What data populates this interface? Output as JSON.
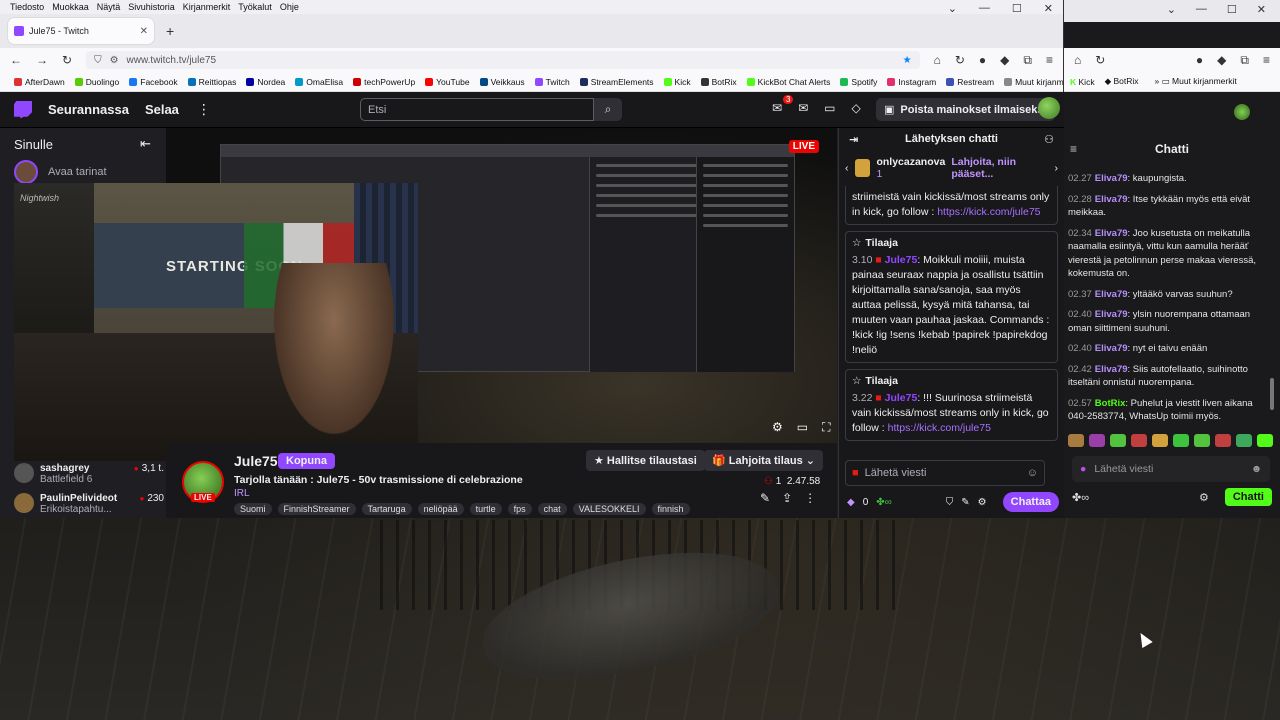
{
  "menubar": [
    "Tiedosto",
    "Muokkaa",
    "Näytä",
    "Sivuhistoria",
    "Kirjanmerkit",
    "Työkalut",
    "Ohje"
  ],
  "tab": {
    "title": "Jule75 - Twitch",
    "close": "✕",
    "new": "+"
  },
  "url": "www.twitch.tv/jule75",
  "bookmarks": [
    {
      "label": "AfterDawn",
      "color": "#d33"
    },
    {
      "label": "Duolingo",
      "color": "#58cc02"
    },
    {
      "label": "Facebook",
      "color": "#1877f2"
    },
    {
      "label": "Reittiopas",
      "color": "#0073bc"
    },
    {
      "label": "Nordea",
      "color": "#0000a0"
    },
    {
      "label": "OmaElisa",
      "color": "#0099cc"
    },
    {
      "label": "techPowerUp",
      "color": "#c00"
    },
    {
      "label": "YouTube",
      "color": "#f00"
    },
    {
      "label": "Veikkaus",
      "color": "#004b87"
    },
    {
      "label": "Twitch",
      "color": "#9147ff"
    },
    {
      "label": "StreamElements",
      "color": "#1f2d5a"
    },
    {
      "label": "Kick",
      "color": "#53fc18"
    },
    {
      "label": "BotRix",
      "color": "#333"
    },
    {
      "label": "KickBot Chat Alerts",
      "color": "#53fc18"
    },
    {
      "label": "Spotify",
      "color": "#1db954"
    },
    {
      "label": "Instagram",
      "color": "#e1306c"
    },
    {
      "label": "Restream",
      "color": "#3f51b5"
    },
    {
      "label": "Muut kirjanmerkit",
      "color": "#888"
    }
  ],
  "twitch": {
    "following": "Seurannassa",
    "browse": "Selaa",
    "search_placeholder": "Etsi",
    "notif_count": "3",
    "ad_free": "Poista mainokset ilmaiseksi"
  },
  "sidebar": {
    "title": "Sinulle",
    "story": "Avaa tarinat",
    "channels": [
      {
        "name": "sashagrey",
        "game": "Battlefield 6",
        "viewers": "3,1 t."
      },
      {
        "name": "PaulinPelivideot",
        "game": "Erikoistapahtu...",
        "viewers": "230"
      }
    ]
  },
  "video": {
    "live": "LIVE",
    "starting": "STARTING SOON",
    "overlay_left": "Nightwish"
  },
  "stream": {
    "name": "Jule75",
    "follow": "Kopuna",
    "live": "LIVE",
    "title": "Tarjolla tänään : Jule75 - 50v trasmissione di celebrazione",
    "game": "IRL",
    "tags": [
      "Suomi",
      "FinnishStreamer",
      "Tartaruga",
      "neliöpää",
      "turtle",
      "fps",
      "chat",
      "VALESOKKELI",
      "finnish"
    ],
    "manage_sub": "Hallitse tilaustasi",
    "gift_sub": "Lahjoita tilaus",
    "viewers": "1",
    "uptime": "2.47.58"
  },
  "twitch_chat": {
    "title": "Lähetyksen chatti",
    "gift_user": "onlycazanova",
    "gift_count": "1",
    "gift_link": "Lahjoita, niin pääset...",
    "msg0_tail": "striimeistä vain kickissä/most streams only in kick, go follow : ",
    "msg0_url": "https://kick.com/jule75",
    "msg1": {
      "tag": "Tilaaja",
      "time": "3.10",
      "user": "Jule75",
      "text": ": Moikkuli moiiii, muista painaa seuraax nappia ja osallistu tsättiin kirjoittamalla sana/sanoja, saa myös auttaa pelissä, kysyä mitä tahansa, tai muuten vaan pauhaa jaskaa. Commands : !kick !ig !sens !kebab !papirek !papirekdog !neliö"
    },
    "msg2": {
      "tag": "Tilaaja",
      "time": "3.22",
      "user": "Jule75",
      "text": ": !!! Suurinosa striimeistä vain kickissä/most streams only in kick, go follow : ",
      "url": "https://kick.com/jule75"
    },
    "input_placeholder": "Lähetä viesti",
    "points": "0",
    "send": "Chattaa"
  },
  "kick": {
    "bookmarks": [
      "Kick",
      "BotRix",
      "Muut kirjanmerkit"
    ],
    "title": "Chatti",
    "messages": [
      {
        "time": "02.27",
        "user": "Eliva79",
        "text": ": kaupungista."
      },
      {
        "time": "02.28",
        "user": "Eliva79",
        "text": ": Itse tykkään myös että eivät meikkaa."
      },
      {
        "time": "02.34",
        "user": "Eliva79",
        "text": ": Joo kusetusta on meikatulla naamalla esiintyä, vittu kun aamulla herääť vierestä ja petolinnun perse makaa vieressä, kokemusta on."
      },
      {
        "time": "02.37",
        "user": "Eliva79",
        "text": ": yltääkö varvas suuhun?"
      },
      {
        "time": "02.40",
        "user": "Eliva79",
        "text": ": ylsin nuorempana ottamaan oman siittimeni suuhuni."
      },
      {
        "time": "02.40",
        "user": "Eliva79",
        "text": ": nyt ei taivu enään"
      },
      {
        "time": "02.42",
        "user": "Eliva79",
        "text": ": Siis autofellaatio, suihinotto itseltäni onnistui nuorempana."
      },
      {
        "time": "02.57",
        "user": "BotRix",
        "text": ": Puhelut ja viestit liven aikana 040-2583774, WhatsUp toimii myös.",
        "bot": true
      }
    ],
    "input_placeholder": "Lähetä viesti",
    "send": "Chatti"
  }
}
